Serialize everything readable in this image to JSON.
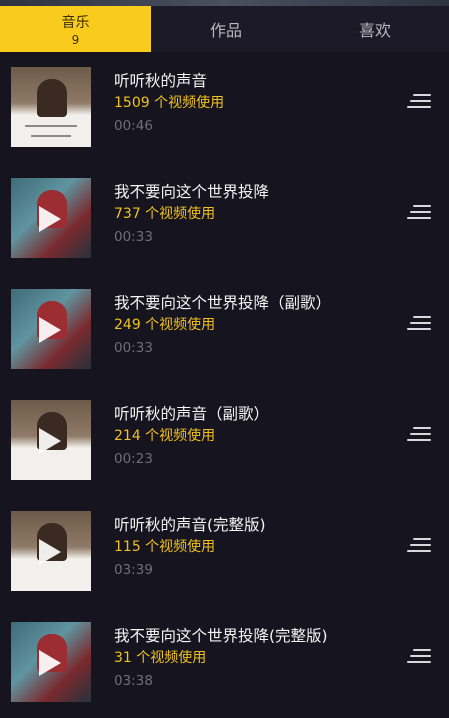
{
  "tabs": [
    {
      "label": "音乐",
      "count": "9",
      "active": true
    },
    {
      "label": "作品",
      "active": false
    },
    {
      "label": "喜欢",
      "active": false
    }
  ],
  "songs": [
    {
      "title": "听听秋的声音",
      "usage": "1509 个视频使用",
      "duration": "00:46",
      "cover": "warm"
    },
    {
      "title": "我不要向这个世界投降",
      "usage": "737 个视频使用",
      "duration": "00:33",
      "cover": "cool"
    },
    {
      "title": "我不要向这个世界投降（副歌）",
      "usage": "249 个视频使用",
      "duration": "00:33",
      "cover": "cool"
    },
    {
      "title": "听听秋的声音（副歌）",
      "usage": "214 个视频使用",
      "duration": "00:23",
      "cover": "warm"
    },
    {
      "title": "听听秋的声音(完整版)",
      "usage": "115 个视频使用",
      "duration": "03:39",
      "cover": "warm"
    },
    {
      "title": "我不要向这个世界投降(完整版)",
      "usage": "31 个视频使用",
      "duration": "03:38",
      "cover": "cool"
    }
  ],
  "colors": {
    "accent": "#f9cb1c",
    "usage": "#f2c21b",
    "background": "#15141f"
  }
}
